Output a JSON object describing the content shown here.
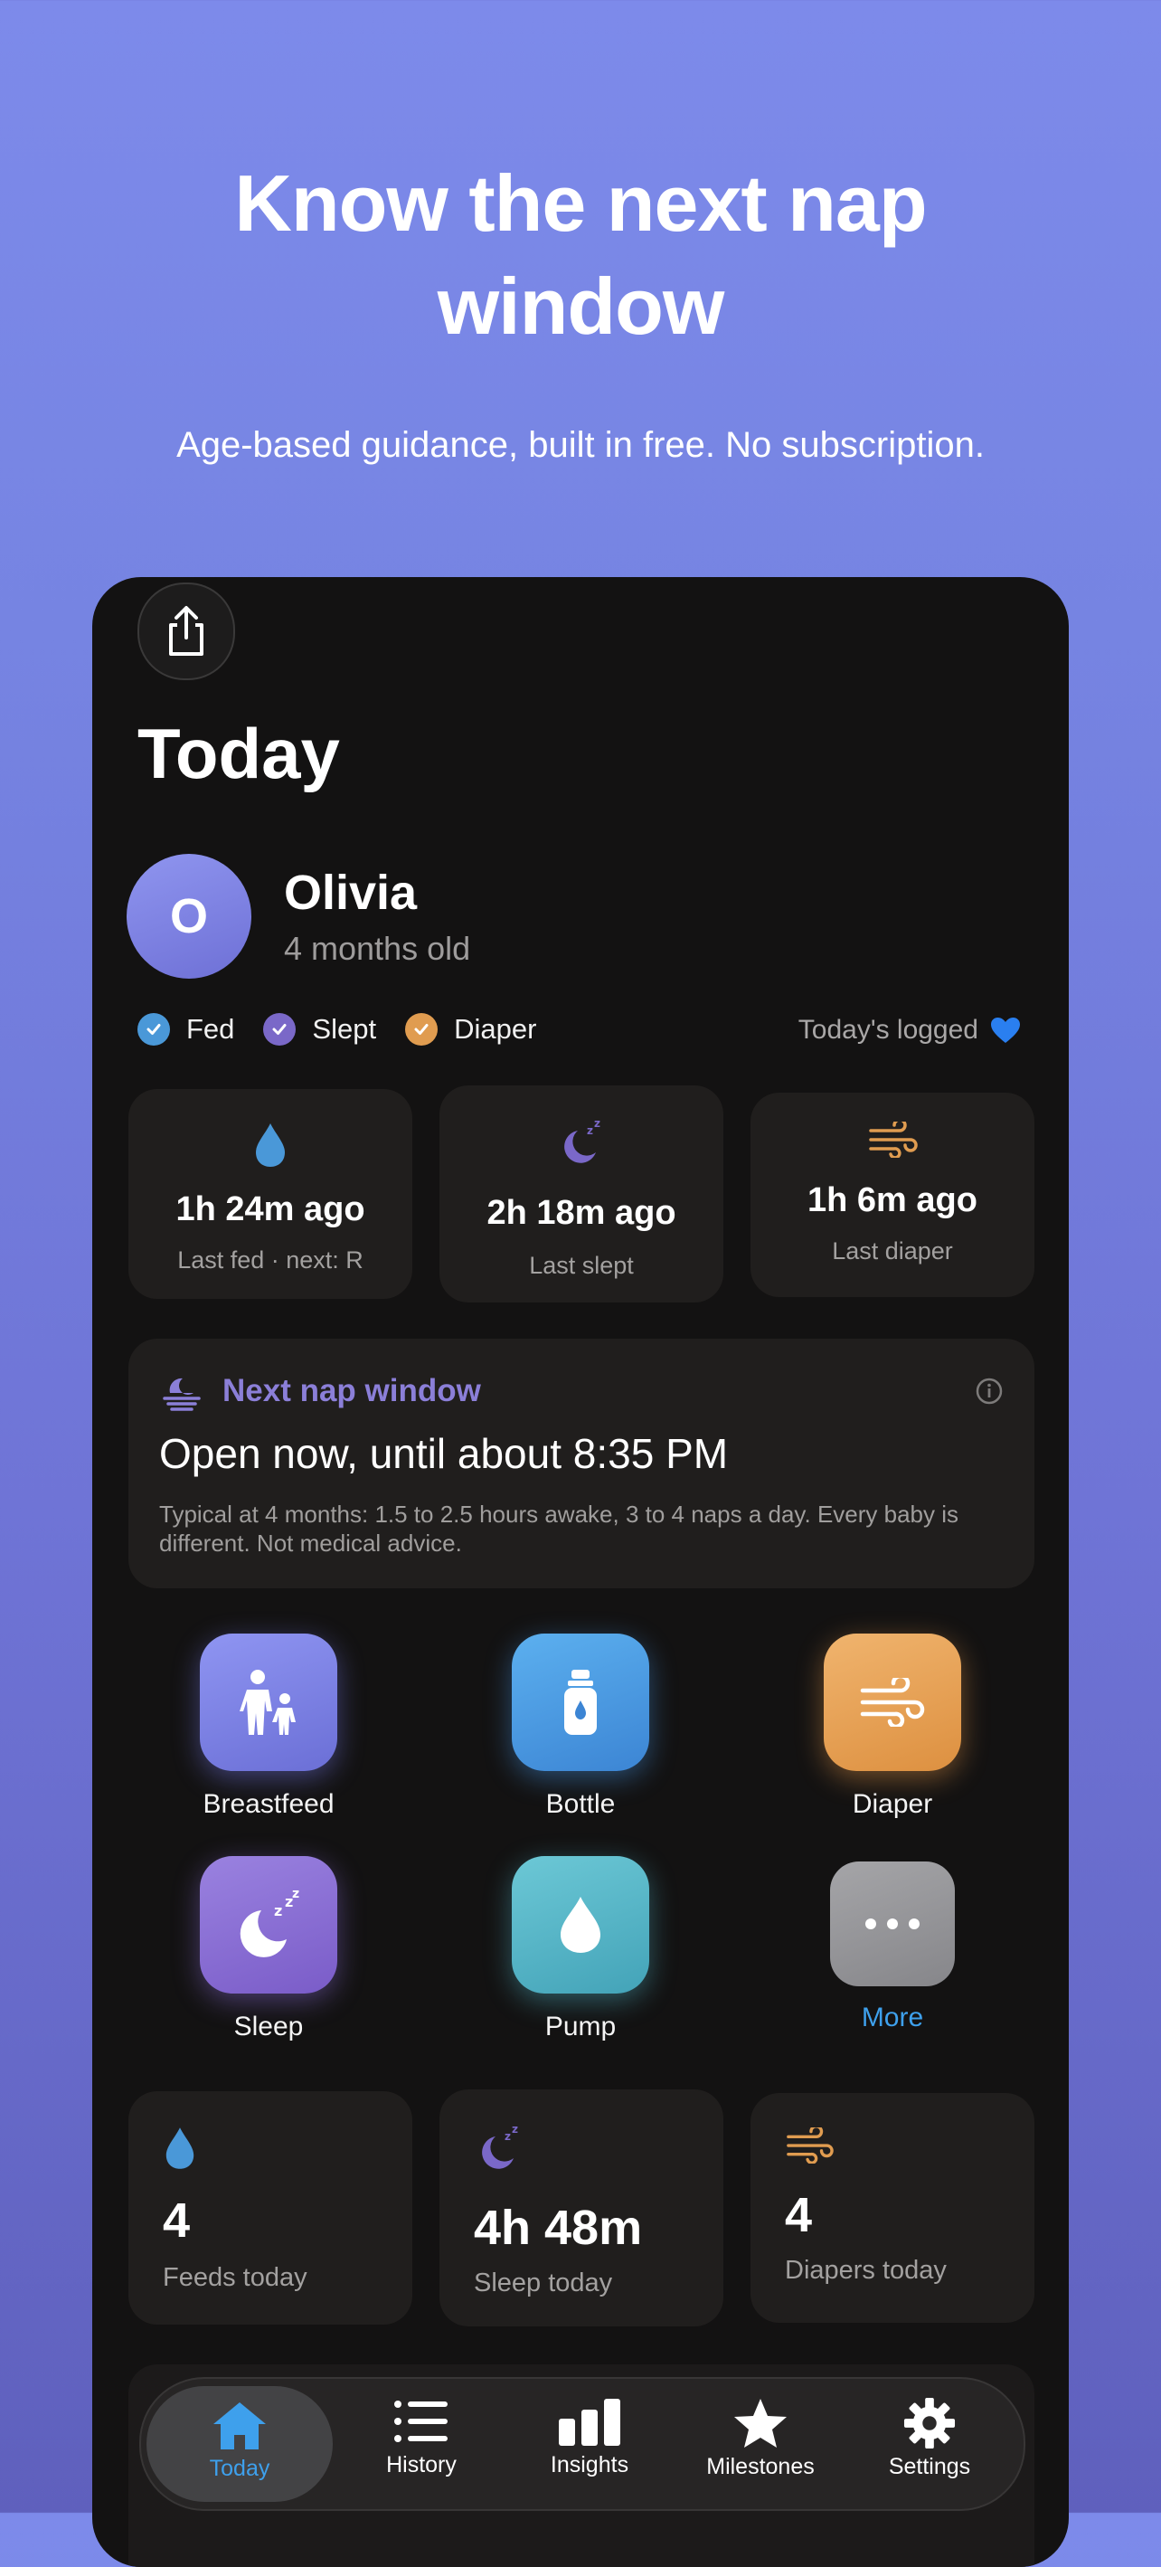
{
  "hero": {
    "title_line1": "Know the next nap",
    "title_line2": "window",
    "subtitle": "Age-based guidance, built in free. No subscription."
  },
  "header": {
    "title": "Today"
  },
  "child": {
    "initial": "O",
    "name": "Olivia",
    "age": "4 months old"
  },
  "checklist": [
    {
      "label": "Fed",
      "color": "#4a98d8"
    },
    {
      "label": "Slept",
      "color": "#7a68c8"
    },
    {
      "label": "Diaper",
      "color": "#e09c50"
    }
  ],
  "logged_text": "Today's logged",
  "status_cards": [
    {
      "value": "1h 24m ago",
      "caption": "Last fed · next: R",
      "icon": "drop-icon"
    },
    {
      "value": "2h 18m ago",
      "caption": "Last slept",
      "icon": "moon-icon"
    },
    {
      "value": "1h 6m ago",
      "caption": "Last diaper",
      "icon": "wind-icon"
    }
  ],
  "nap": {
    "title": "Next nap window",
    "status": "Open now, until about 8:35 PM",
    "note": "Typical at 4 months: 1.5 to 2.5 hours awake, 3 to 4 naps a day. Every baby is different. Not medical advice."
  },
  "quick_actions": [
    {
      "label": "Breastfeed",
      "icon": "parent-child-icon"
    },
    {
      "label": "Bottle",
      "icon": "bottle-icon"
    },
    {
      "label": "Diaper",
      "icon": "wind-icon"
    },
    {
      "label": "Sleep",
      "icon": "moon-icon"
    },
    {
      "label": "Pump",
      "icon": "drop-icon"
    },
    {
      "label": "More",
      "icon": "ellipsis-icon"
    }
  ],
  "summary": [
    {
      "value": "4",
      "caption": "Feeds today"
    },
    {
      "value": "4h 48m",
      "caption": "Sleep today"
    },
    {
      "value": "4",
      "caption": "Diapers today"
    }
  ],
  "tabs": [
    {
      "label": "Today",
      "active": true
    },
    {
      "label": "History"
    },
    {
      "label": "Insights"
    },
    {
      "label": "Milestones"
    },
    {
      "label": "Settings"
    }
  ],
  "colors": {
    "accent_blue": "#3ea0ec",
    "feed_blue": "#4a98d8",
    "sleep_purple": "#7a68c8",
    "diaper_orange": "#e09c50"
  }
}
